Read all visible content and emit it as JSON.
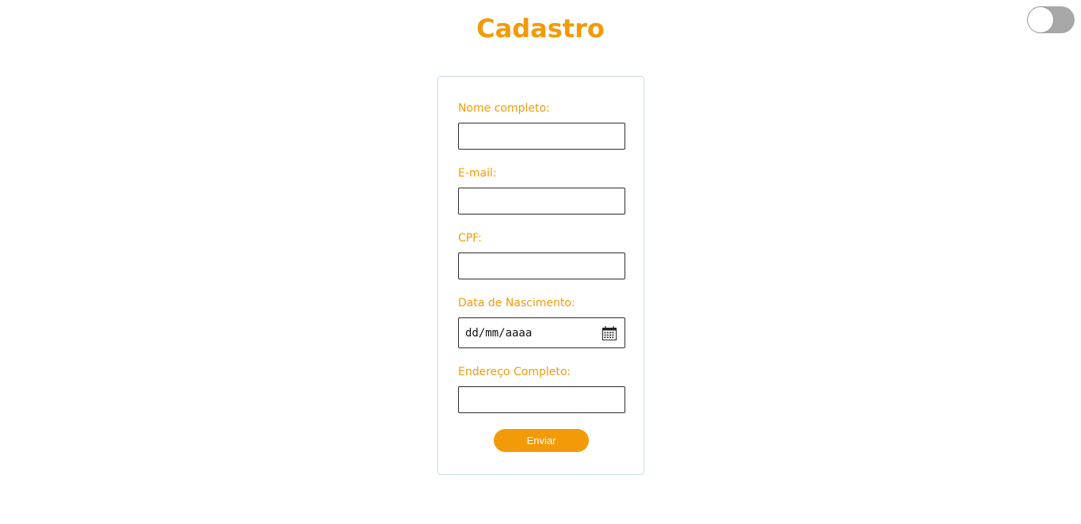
{
  "header": {
    "title": "Cadastro"
  },
  "theme_toggle": {
    "state": "off",
    "track_color": "#a8a8a8",
    "knob_color": "#ffffff"
  },
  "form": {
    "fields": [
      {
        "label": "Nome completo:",
        "value": ""
      },
      {
        "label": "E-mail:",
        "value": ""
      },
      {
        "label": "CPF:",
        "value": ""
      },
      {
        "label": "Data de Nascimento:",
        "placeholder": "dd/mm/aaaa",
        "icon": "calendar-icon"
      },
      {
        "label": "Endereço Completo:",
        "value": ""
      }
    ],
    "submit_label": "Enviar"
  },
  "colors": {
    "accent": "#f39a08",
    "card_border": "#c9dde6",
    "input_border": "#2b2b2b"
  }
}
